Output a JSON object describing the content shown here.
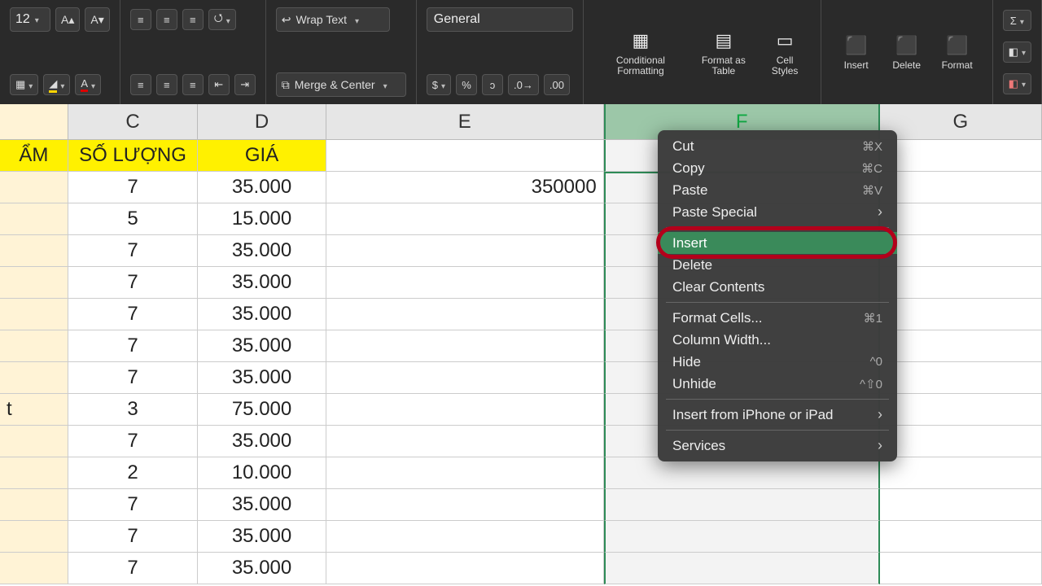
{
  "ribbon": {
    "font_size": "12",
    "wrap_text": "Wrap Text",
    "merge_center": "Merge & Center",
    "number_format": "General",
    "cond_fmt": "Conditional Formatting",
    "fmt_table": "Format as Table",
    "cell_styles": "Cell Styles",
    "insert": "Insert",
    "delete": "Delete",
    "format": "Format"
  },
  "columns": {
    "B": "ẨM",
    "C": "C",
    "D": "D",
    "E": "E",
    "F": "F",
    "G": "G"
  },
  "headers": {
    "B": "ẨM",
    "C": "SỐ LƯỢNG",
    "D": "GIÁ"
  },
  "rows": [
    {
      "b": "",
      "c": "7",
      "d": "35.000",
      "e": "350000"
    },
    {
      "b": "",
      "c": "5",
      "d": "15.000",
      "e": ""
    },
    {
      "b": "",
      "c": "7",
      "d": "35.000",
      "e": ""
    },
    {
      "b": "",
      "c": "7",
      "d": "35.000",
      "e": ""
    },
    {
      "b": "",
      "c": "7",
      "d": "35.000",
      "e": ""
    },
    {
      "b": "",
      "c": "7",
      "d": "35.000",
      "e": ""
    },
    {
      "b": "",
      "c": "7",
      "d": "35.000",
      "e": ""
    },
    {
      "b": "t",
      "c": "3",
      "d": "75.000",
      "e": ""
    },
    {
      "b": "",
      "c": "7",
      "d": "35.000",
      "e": ""
    },
    {
      "b": "",
      "c": "2",
      "d": "10.000",
      "e": ""
    },
    {
      "b": "",
      "c": "7",
      "d": "35.000",
      "e": ""
    },
    {
      "b": "",
      "c": "7",
      "d": "35.000",
      "e": ""
    },
    {
      "b": "",
      "c": "7",
      "d": "35.000",
      "e": ""
    }
  ],
  "ctx": {
    "cut": "Cut",
    "cut_sc": "⌘X",
    "copy": "Copy",
    "copy_sc": "⌘C",
    "paste": "Paste",
    "paste_sc": "⌘V",
    "paste_special": "Paste Special",
    "insert": "Insert",
    "delete": "Delete",
    "clear": "Clear Contents",
    "format_cells": "Format Cells...",
    "format_cells_sc": "⌘1",
    "col_width": "Column Width...",
    "hide": "Hide",
    "hide_sc": "^0",
    "unhide": "Unhide",
    "unhide_sc": "^⇧0",
    "insert_iphone": "Insert from iPhone or iPad",
    "services": "Services"
  }
}
